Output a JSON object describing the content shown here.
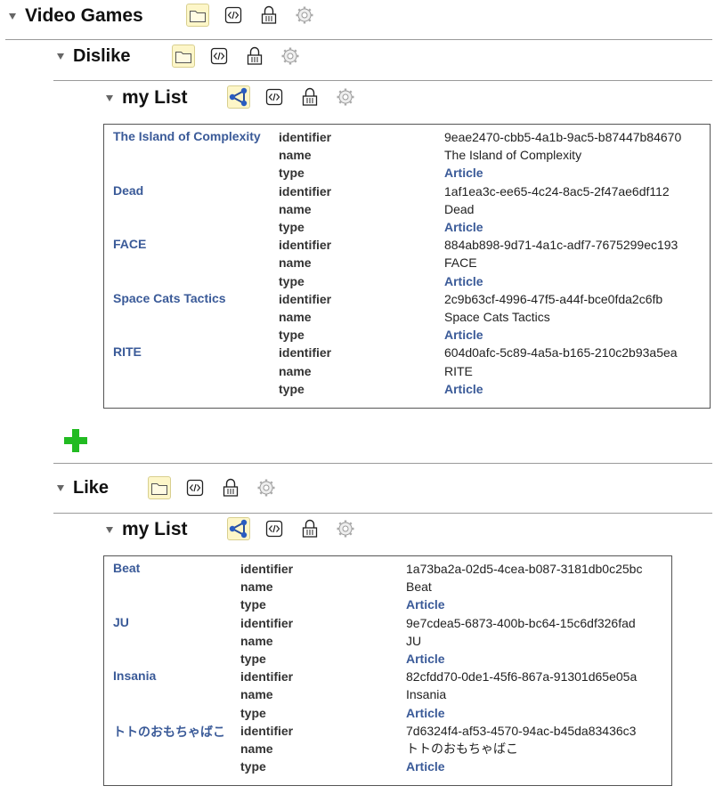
{
  "root": {
    "title": "Video Games"
  },
  "sections": [
    {
      "title": "Dislike",
      "list": {
        "title": "my List",
        "items": [
          {
            "title": "The Island of Complexity",
            "identifier": "9eae2470-cbb5-4a1b-9ac5-b87447b84670",
            "name": "The Island of Complexity",
            "type": "Article"
          },
          {
            "title": "Dead",
            "identifier": "1af1ea3c-ee65-4c24-8ac5-2f47ae6df112",
            "name": "Dead",
            "type": "Article"
          },
          {
            "title": "FACE",
            "identifier": "884ab898-9d71-4a1c-adf7-7675299ec193",
            "name": "FACE",
            "type": "Article"
          },
          {
            "title": "Space Cats Tactics",
            "identifier": "2c9b63cf-4996-47f5-a44f-bce0fda2c6fb",
            "name": "Space Cats Tactics",
            "type": "Article"
          },
          {
            "title": "RITE",
            "identifier": "604d0afc-5c89-4a5a-b165-210c2b93a5ea",
            "name": "RITE",
            "type": "Article"
          }
        ]
      }
    },
    {
      "title": "Like",
      "list": {
        "title": "my List",
        "items": [
          {
            "title": "Beat",
            "identifier": "1a73ba2a-02d5-4cea-b087-3181db0c25bc",
            "name": "Beat",
            "type": "Article"
          },
          {
            "title": "JU",
            "identifier": "9e7cdea5-6873-400b-bc64-15c6df326fad",
            "name": "JU",
            "type": "Article"
          },
          {
            "title": "Insania",
            "identifier": "82cfdd70-0de1-45f6-867a-91301d65e05a",
            "name": "Insania",
            "type": "Article"
          },
          {
            "title": "トトのおもちゃばこ",
            "identifier": "7d6324f4-af53-4570-94ac-b45da83436c3",
            "name": "トトのおもちゃばこ",
            "type": "Article"
          }
        ]
      }
    }
  ],
  "labels": {
    "identifier": "identifier",
    "name": "name",
    "type": "type"
  },
  "icons": {
    "folder": "folder-icon",
    "code": "code-icon",
    "lock": "lock-icon",
    "gear": "gear-icon",
    "graph": "graph-icon",
    "add": "add-icon"
  },
  "colors": {
    "link": "#3a5a98",
    "add": "#22bb22",
    "selected_bg": "#fdf6c8"
  }
}
